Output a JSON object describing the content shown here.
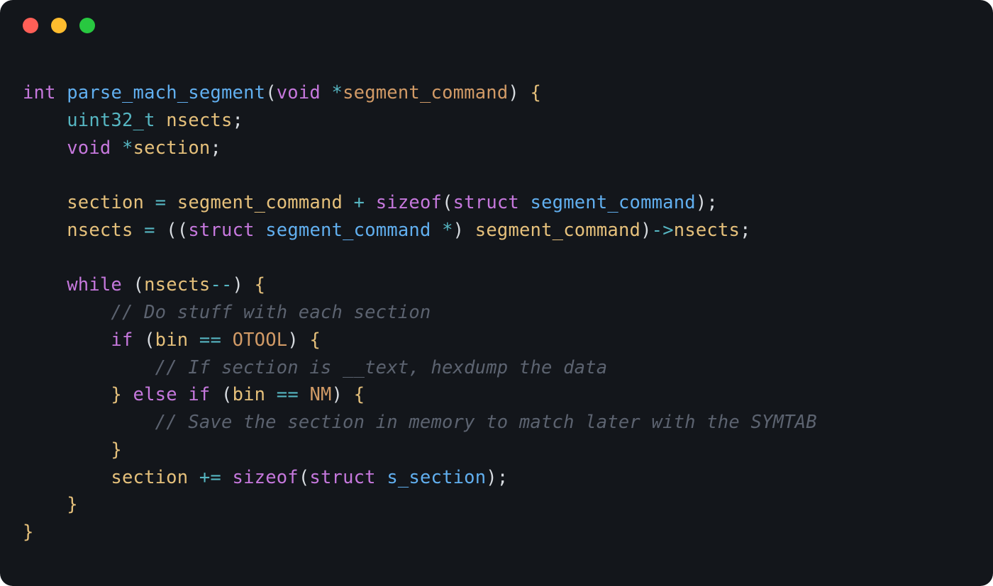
{
  "traffic": {
    "red": "#ff5f57",
    "yellow": "#febc2e",
    "green": "#28c840"
  },
  "tok": {
    "int": "int",
    "void": "void",
    "struct": "struct",
    "while": "while",
    "if": "if",
    "else": "else",
    "sizeof": "sizeof",
    "uint32_t": "uint32_t",
    "parse_mach_segment": "parse_mach_segment",
    "segment_command": "segment_command",
    "nsects": "nsects",
    "section": "section",
    "s_section": "s_section",
    "bin": "bin",
    "OTOOL": "OTOOL",
    "NM": "NM",
    "comment1": "// Do stuff with each section",
    "comment2": "// If section is __text, hexdump the data",
    "comment3": "// Save the section in memory to match later with the SYMTAB",
    "star": "*",
    "lparen": "(",
    "rparen": ")",
    "lbrace": "{",
    "rbrace": "}",
    "semi": ";",
    "eq": "=",
    "plus": "+",
    "eqeq": "==",
    "arrow": "->",
    "minusminus": "--",
    "pluseq": "+="
  }
}
